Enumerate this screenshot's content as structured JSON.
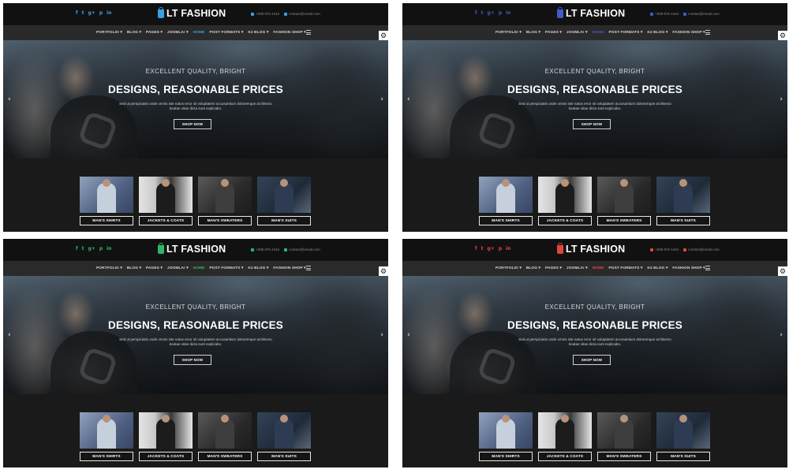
{
  "variants": [
    {
      "accent": "#3aa0e6",
      "active_nav": 5
    },
    {
      "accent": "#3f5cc8",
      "active_nav": 5
    },
    {
      "accent": "#2fb56a",
      "active_nav": 5
    },
    {
      "accent": "#e0473a",
      "active_nav": 5
    }
  ],
  "header": {
    "social_icons": [
      "facebook-icon",
      "twitter-icon",
      "google-plus-icon",
      "pinterest-icon",
      "linkedin-icon"
    ],
    "social_glyphs": [
      "f",
      "t",
      "g+",
      "p",
      "in"
    ],
    "logo": "LT FASHION",
    "phone": "+008 876 4444",
    "email": "contact@email.com"
  },
  "nav": {
    "items": [
      "PORTFOLIO ▾",
      "BLOG ▾",
      "PAGES ▾",
      "JOOMLA! ▾",
      "HOME",
      "POST FORMATS ▾",
      "K2 BLOG ▾",
      "FASHION SHOP ▾"
    ]
  },
  "hero": {
    "subtitle": "EXCELLENT QUALITY, BRIGHT",
    "title": "DESIGNS, REASONABLE PRICES",
    "desc_line1": "Sed ut perspiciatis unde omnis iste natus error sit voluptatem accusantium doloremque architecto",
    "desc_line2": "beatae vitae dicta sunt explicabo.",
    "button": "SHOP NOW"
  },
  "categories": [
    "MAN'S SHIRTS",
    "JACKETS & COATS",
    "MAN'S SWEATERS",
    "MAN'S SUITS"
  ]
}
